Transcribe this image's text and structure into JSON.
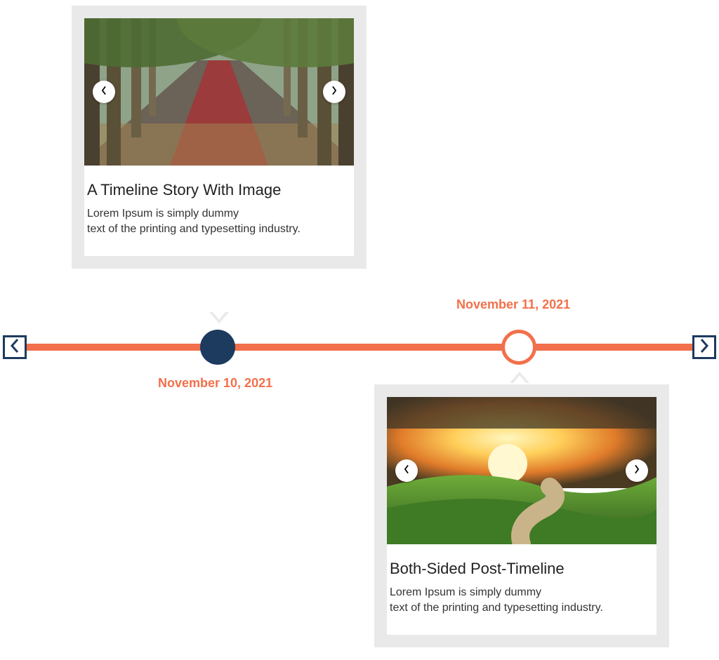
{
  "timeline": {
    "events": [
      {
        "date": "November 10, 2021",
        "node_style": "filled",
        "card_position": "above",
        "title": "A Timeline Story With Image",
        "body": "Lorem Ipsum is simply dummy\ntext of the printing and typesetting industry.",
        "image_alt": "tree-lined road"
      },
      {
        "date": "November 11, 2021",
        "node_style": "hollow",
        "card_position": "below",
        "title": "Both-Sided Post-Timeline",
        "body": "Lorem Ipsum is simply dummy\ntext of the printing and typesetting industry.",
        "image_alt": "sunset over green hills"
      }
    ]
  },
  "colors": {
    "axis": "#f2704b",
    "accent_dark": "#1d3a5f"
  }
}
